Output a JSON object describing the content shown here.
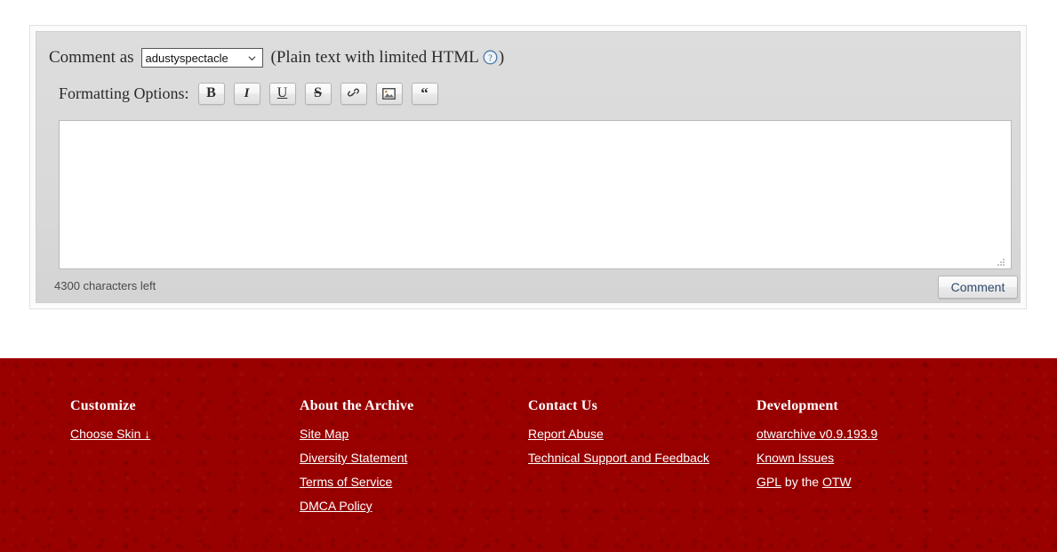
{
  "comment_form": {
    "comment_as_label": "Comment as",
    "user_select": {
      "selected": "adustyspectacle",
      "options": [
        "adustyspectacle"
      ],
      "chevron_icon": "chevron-down-icon"
    },
    "plain_text_note_open": "(Plain text with limited HTML",
    "plain_text_note_close": ")",
    "help_icon": "question-mark-circle-icon",
    "formatting_label": "Formatting Options:",
    "formatting_buttons": [
      {
        "name": "bold-button",
        "label": "B",
        "icon": "bold-icon"
      },
      {
        "name": "italic-button",
        "label": "I",
        "icon": "italic-icon"
      },
      {
        "name": "underline-button",
        "label": "U",
        "icon": "underline-icon"
      },
      {
        "name": "strikethrough-button",
        "label": "S",
        "icon": "strikethrough-icon"
      },
      {
        "name": "link-button",
        "label": "",
        "icon": "link-icon"
      },
      {
        "name": "image-button",
        "label": "",
        "icon": "image-icon"
      },
      {
        "name": "quote-button",
        "label": "“",
        "icon": "quote-icon"
      }
    ],
    "textarea": {
      "value": "",
      "placeholder": ""
    },
    "resize_grip_icon": "resize-handle-icon",
    "characters_left": "4300 characters left",
    "submit_label": "Comment"
  },
  "footer": {
    "background_color": "#990000",
    "text_color": "#ffffff",
    "columns": [
      {
        "heading": "Customize",
        "links": [
          {
            "text": "Choose Skin ↓",
            "name": "footer-link-choose-skin"
          }
        ]
      },
      {
        "heading": "About the Archive",
        "links": [
          {
            "text": "Site Map",
            "name": "footer-link-site-map"
          },
          {
            "text": "Diversity Statement",
            "name": "footer-link-diversity-statement"
          },
          {
            "text": "Terms of Service",
            "name": "footer-link-terms-of-service"
          },
          {
            "text": "DMCA Policy",
            "name": "footer-link-dmca-policy"
          }
        ]
      },
      {
        "heading": "Contact Us",
        "links": [
          {
            "text": "Report Abuse",
            "name": "footer-link-report-abuse"
          },
          {
            "text": "Technical Support and Feedback",
            "name": "footer-link-technical-support"
          }
        ]
      },
      {
        "heading": "Development",
        "links": [
          {
            "text": "otwarchive v0.9.193.9",
            "name": "footer-link-otwarchive-version"
          },
          {
            "text": "Known Issues",
            "name": "footer-link-known-issues"
          }
        ],
        "license_line": {
          "gpl": "GPL",
          "middle": " by the ",
          "otw": "OTW"
        }
      }
    ]
  }
}
